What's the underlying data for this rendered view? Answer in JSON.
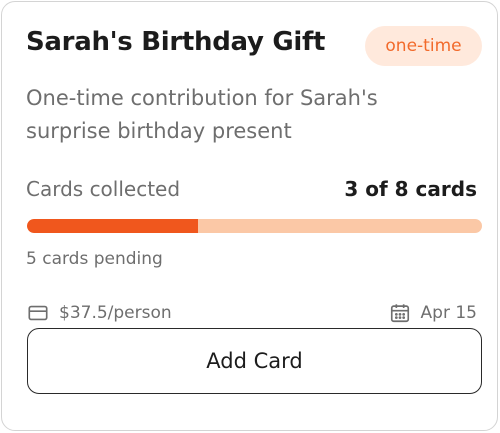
{
  "card": {
    "title": "Sarah's Birthday Gift",
    "badge": "one-time",
    "description": "One-time contribution for Sarah's surprise birthday present",
    "cards_label": "Cards collected",
    "cards_count": "3 of 8 cards",
    "progress_fraction": 0.375,
    "pending": "5 cards pending",
    "per_person": "$37.5/person",
    "date": "Apr 15",
    "add_button": "Add Card",
    "icons": {
      "per_person": "credit-card-icon",
      "date": "calendar-icon"
    },
    "colors": {
      "accent": "#f0571d",
      "progress_track": "#fbc8a6",
      "badge_bg": "#ffe9dc",
      "badge_text": "#f26a2b"
    }
  }
}
